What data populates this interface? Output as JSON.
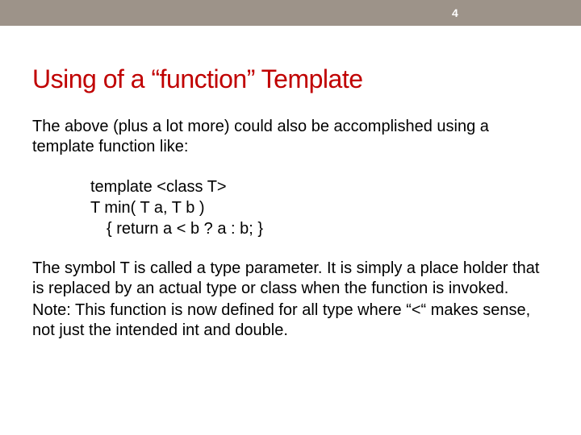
{
  "slide_number": "4",
  "title": "Using of a “function” Template",
  "paragraph1": "The above (plus a lot more) could also be accomplished using a template function like:",
  "code": {
    "line1": "template <class T>",
    "line2": "T min( T a, T b )",
    "line3": "{ return a < b ? a : b; }"
  },
  "paragraph2": "The symbol T is called a type parameter.  It is simply a place holder that is replaced by an actual type or class when the function is invoked.",
  "paragraph3": "Note: This function is now defined for all type where “<“ makes sense, not just the intended int and double."
}
